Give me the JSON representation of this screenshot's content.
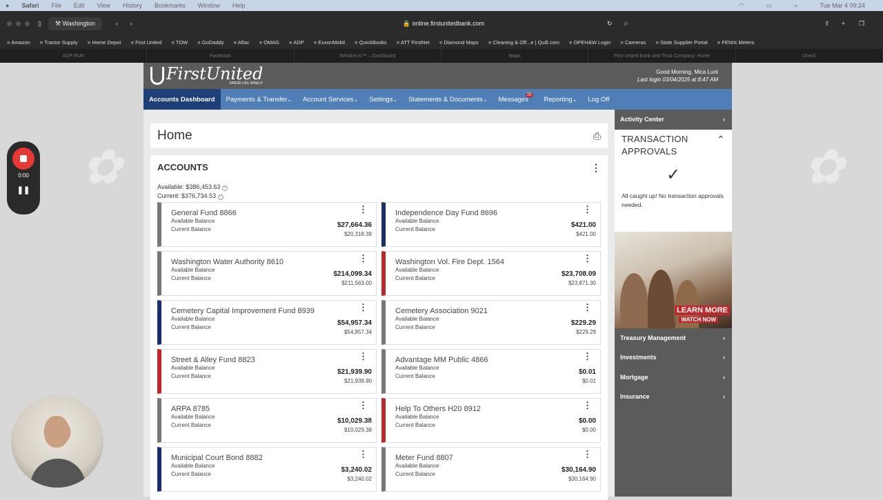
{
  "os": {
    "app": "Safari",
    "menus": [
      "File",
      "Edit",
      "View",
      "History",
      "Bookmarks",
      "Window",
      "Help"
    ],
    "clock": "Tue Mar 4  09:24"
  },
  "browser": {
    "tab_group": "Washington",
    "url": "online.firstunitedbank.com",
    "favorites": [
      "Amazon",
      "Tractor Supply",
      "Home Depot",
      "First United",
      "TOW",
      "GoDaddy",
      "Aflac",
      "OMAG",
      "ADP",
      "ExxonMobil",
      "QuickBooks",
      "ATT FirstNet",
      "Diamond Maps",
      "Cleaning & Off...e | Quill.com",
      "OPEH&W Login",
      "Cameras",
      "State Supplier Portal",
      "FENIX Meters"
    ],
    "tabs": [
      "ADP RUN",
      "Facebook",
      "Whisker.io™ – Dashboard",
      "Maps",
      "First United Bank and Trust Company: Home",
      "Check"
    ]
  },
  "header": {
    "logo_name": "FirstUnited",
    "logo_tagline": "SPEND LIFE WISELY",
    "greeting": "Good Morning, Mica Lunt",
    "last_login": "Last login 03/04/2025 at 8:47 AM"
  },
  "nav": {
    "dashboard": "Accounts Dashboard",
    "payments": "Payments & Transfer",
    "services": "Account Services",
    "settings": "Settings",
    "statements": "Statements & Documents",
    "messages": "Messages",
    "messages_count": "25",
    "reporting": "Reporting",
    "logoff": "Log Off"
  },
  "main": {
    "title": "Home",
    "accounts_title": "ACCOUNTS",
    "available_total": "Available: $386,453.63",
    "current_total": "Current: $376,734.53",
    "available_label": "Available Balance",
    "current_label": "Current Balance",
    "accounts": [
      {
        "name": "General Fund 8866",
        "available": "$27,664.36",
        "current": "$20,318.39",
        "color": "gray"
      },
      {
        "name": "Independence Day Fund 8696",
        "available": "$421.00",
        "current": "$421.00",
        "color": "blue"
      },
      {
        "name": "Washington Water Authority 8610",
        "available": "$214,099.34",
        "current": "$211,563.00",
        "color": "gray"
      },
      {
        "name": "Washington Vol. Fire Dept. 1564",
        "available": "$23,708.09",
        "current": "$23,871.30",
        "color": "red"
      },
      {
        "name": "Cemetery Capital Improvement Fund 8939",
        "available": "$54,957.34",
        "current": "$54,957.34",
        "color": "blue"
      },
      {
        "name": "Cemetery Association 9021",
        "available": "$229.29",
        "current": "$229.29",
        "color": "gray"
      },
      {
        "name": "Street & Alley Fund 8823",
        "available": "$21,939.90",
        "current": "$21,939.90",
        "color": "red"
      },
      {
        "name": "Advantage MM Public 4866",
        "available": "$0.01",
        "current": "$0.01",
        "color": "gray"
      },
      {
        "name": "ARPA 8785",
        "available": "$10,029.38",
        "current": "$10,029.38",
        "color": "gray"
      },
      {
        "name": "Help To Others H20 8912",
        "available": "$0.00",
        "current": "$0.00",
        "color": "red"
      },
      {
        "name": "Municipal Court Bond 8882",
        "available": "$3,240.02",
        "current": "$3,240.02",
        "color": "blue"
      },
      {
        "name": "Meter Fund 8807",
        "available": "$30,164.90",
        "current": "$30,164.90",
        "color": "gray"
      }
    ]
  },
  "sidebar": {
    "activity": "Activity Center",
    "approvals_title": "TRANSACTION APPROVALS",
    "approvals_msg": "All caught up! No transaction approvals needed.",
    "promo_cta": "LEARN MORE",
    "promo_sub": "WATCH NOW",
    "items": [
      "Treasury Management",
      "Investments",
      "Mortgage",
      "Insurance"
    ]
  },
  "recorder": {
    "time": "0:00"
  }
}
